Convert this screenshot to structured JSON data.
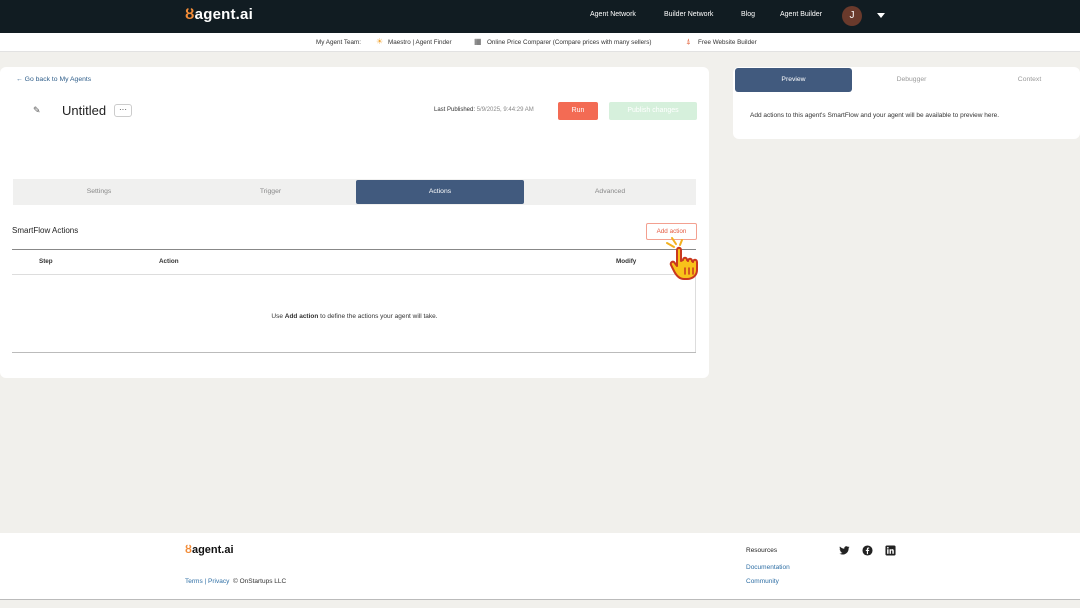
{
  "header": {
    "logo_mark": "ȣ",
    "logo_text": "agent.ai",
    "nav": [
      "Agent Network",
      "Builder Network",
      "Blog",
      "Agent Builder"
    ],
    "avatar_initial": "J"
  },
  "team_bar": {
    "label": "My Agent Team:",
    "items": [
      {
        "icon": "sun-icon",
        "glyph": "☀",
        "label": "Maestro | Agent Finder"
      },
      {
        "icon": "price-icon",
        "glyph": "▦",
        "label": "Online Price Comparer (Compare prices with many sellers)"
      },
      {
        "icon": "rocket-icon",
        "glyph": "⍋",
        "label": "Free Website Builder"
      }
    ]
  },
  "editor": {
    "back_link": "←  Go back to My Agents",
    "agent_title": "Untitled",
    "more_label": "···",
    "last_published_label": "Last Published:",
    "last_published_value": "5/9/2025, 9:44:29 AM",
    "run_label": "Run",
    "publish_label": "Publish changes",
    "tabs": [
      "Settings",
      "Trigger",
      "Actions",
      "Advanced"
    ],
    "active_tab": "Actions",
    "section_title": "SmartFlow Actions",
    "add_action_label": "Add action",
    "columns": [
      "Step",
      "Action",
      "Modify"
    ],
    "empty_pre": "Use ",
    "empty_bold": "Add action",
    "empty_post": " to define the actions your agent will take."
  },
  "side_panel": {
    "tabs": [
      "Preview",
      "Debugger",
      "Context"
    ],
    "active_tab": "Preview",
    "message": "Add actions to this agent's SmartFlow and your agent will be available to preview here."
  },
  "footer": {
    "logo_mark": "ȣ",
    "logo_text": "agent.ai",
    "terms": "Terms",
    "separator": "|",
    "privacy": "Privacy",
    "copyright": "© OnStartups LLC",
    "resources_title": "Resources",
    "resources_links": [
      "Documentation",
      "Community"
    ],
    "social": [
      "twitter-icon",
      "facebook-icon",
      "linkedin-icon"
    ]
  },
  "colors": {
    "topbar": "#111c22",
    "accent_orange": "#f36b54",
    "active_tab": "#415a7e",
    "link_blue": "#2f5e8a"
  }
}
